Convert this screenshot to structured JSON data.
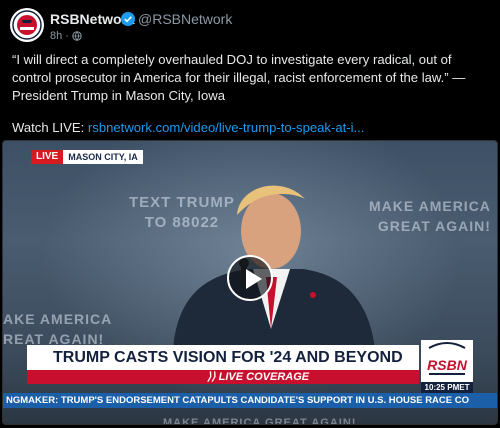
{
  "post": {
    "author_name": "RSBNetwork",
    "author_handle": "@RSBNetwork",
    "time_ago": "8h",
    "body_text": "“I will direct a completely overhauled DOJ to investigate every radical, out of control prosecutor in America for their illegal, racist enforcement of the law.” — President Trump in Mason City, Iowa",
    "watch_prefix": "Watch LIVE: ",
    "watch_link": "rsbnetwork.com/video/live-trump-to-speak-at-i..."
  },
  "icons": {
    "avatar": "rsbn-logo",
    "verified": "verified-badge-icon",
    "visibility": "globe-icon",
    "play": "play-icon"
  },
  "video": {
    "live_tag": "LIVE",
    "location": "MASON CITY, IA",
    "backdrop_text_trump": "TEXT TRUMP\nTO 88022",
    "backdrop_make_right": "MAKE AMERICA\nGREAT AGAIN!",
    "backdrop_make_left": "AKE AMERICA\nREAT AGAIN!",
    "backdrop_make_bottom": "MAKE AMERICA GREAT AGAIN!",
    "headline": "TRUMP CASTS VISION FOR '24 AND BEYOND",
    "coverage": "LIVE COVERAGE",
    "logo_text": "RSBN",
    "clock": "10:25 PMET",
    "ticker": "NGMAKER: TRUMP'S ENDORSEMENT CATAPULTS CANDIDATE'S SUPPORT IN U.S. HOUSE RACE     CO"
  },
  "colors": {
    "link": "#1d9bf0",
    "verified": "#1d9bf0",
    "live_red": "#d71920",
    "coverage_red": "#c8102e",
    "navy": "#14213d",
    "ticker_blue": "#1b5fa8"
  }
}
